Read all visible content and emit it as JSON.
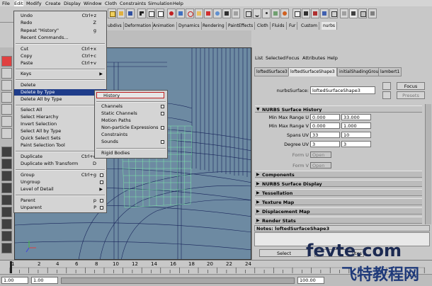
{
  "menubar": [
    "File",
    "Edit",
    "Modify",
    "Create",
    "Display",
    "Window",
    "Cloth",
    "Constraints",
    "Simulation",
    "Help"
  ],
  "shelf": {
    "tabs": [
      "ubdivs",
      "Deformation",
      "Animation",
      "Dynamics",
      "Rendering",
      "PaintEffects",
      "Cloth",
      "Fluids",
      "Fur",
      "Custom",
      "nurbs"
    ],
    "active_tab": "nurbs"
  },
  "edit_menu": {
    "items": [
      {
        "label": "Undo",
        "shortcut": "Ctrl+z"
      },
      {
        "label": "Redo",
        "shortcut": "Z"
      },
      {
        "label": "Repeat \"History\"",
        "shortcut": "g"
      },
      {
        "label": "Recent Commands..."
      },
      {
        "label": "Cut",
        "shortcut": "Ctrl+x"
      },
      {
        "label": "Copy",
        "shortcut": "Ctrl+c"
      },
      {
        "label": "Paste",
        "shortcut": "Ctrl+v"
      },
      {
        "label": "Keys"
      },
      {
        "label": "Delete"
      },
      {
        "label": "Delete by Type"
      },
      {
        "label": "Delete All by Type"
      },
      {
        "label": "Select All"
      },
      {
        "label": "Select Hierarchy"
      },
      {
        "label": "Invert Selection"
      },
      {
        "label": "Select All by Type"
      },
      {
        "label": "Quick Select Sets"
      },
      {
        "label": "Paint Selection Tool"
      },
      {
        "label": "Duplicate",
        "shortcut": "Ctrl+d"
      },
      {
        "label": "Duplicate with Transform",
        "shortcut": "D"
      },
      {
        "label": "Group",
        "shortcut": "Ctrl+g"
      },
      {
        "label": "Ungroup"
      },
      {
        "label": "Level of Detail"
      },
      {
        "label": "Parent",
        "shortcut": "p"
      },
      {
        "label": "Unparent",
        "shortcut": "P"
      }
    ]
  },
  "delete_by_type_menu": {
    "items": [
      "History",
      "Channels",
      "Static Channels",
      "Motion Paths",
      "Non-particle Expressions",
      "Constraints",
      "Sounds",
      "Rigid Bodies"
    ]
  },
  "attribute_editor": {
    "menu": [
      "List",
      "Selected",
      "Focus",
      "Attributes",
      "Help"
    ],
    "tabs": [
      "loftedSurface3",
      "loftedSurfaceShape3",
      "initialShadingGroup",
      "lambert1"
    ],
    "active_tab": "loftedSurfaceShape3",
    "node_label": "nurbsSurface:",
    "node_value": "loftedSurfaceShape3",
    "focus_button": "Focus",
    "presets_button": "Presets",
    "history_section": "NURBS Surface History",
    "fields": {
      "min_max_u_label": "Min Max Range U",
      "min_u": "0.000",
      "max_u": "33.000",
      "min_max_v_label": "Min Max Range V",
      "min_v": "0.000",
      "max_v": "1.000",
      "spans_label": "Spans UV",
      "spans_u": "33",
      "spans_v": "10",
      "degree_label": "Degree UV",
      "degree_u": "3",
      "degree_v": "3",
      "form_u_label": "Form U",
      "form_u": "Open",
      "form_v_label": "Form V",
      "form_v": "Open"
    },
    "sections": [
      "Components",
      "NURBS Surface Display",
      "Tessellation",
      "Texture Map",
      "Displacement Map",
      "Render Stats"
    ],
    "notes": "Notes: loftedSurfaceShape3",
    "select_button": "Select",
    "third_button": "utes"
  },
  "timeline": {
    "ticks": [
      "1",
      "2",
      "4",
      "6",
      "8",
      "10",
      "12",
      "14",
      "16",
      "18",
      "20",
      "22",
      "24"
    ],
    "start_time": "1.00",
    "end_value": "100.00",
    "range_start": "1.00"
  },
  "watermark": {
    "line1": "fevte.com",
    "line2": "飞特教程网"
  },
  "colors": {
    "menu_highlight": "#1e3c8a",
    "viewport_bg": "#6d8aa2",
    "history_outline": "#c02020",
    "wire_selected": "#7fe8a8"
  }
}
